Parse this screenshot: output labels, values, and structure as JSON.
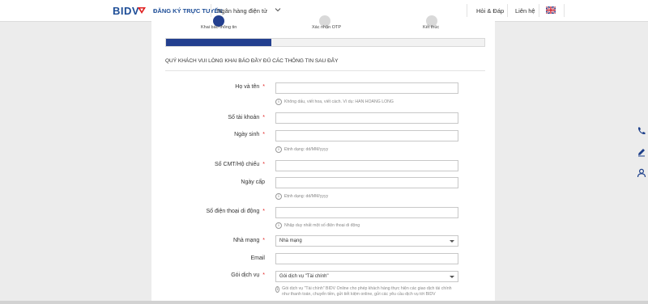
{
  "header": {
    "logo_text": "BIDV",
    "register_title": "ĐĂNG KÝ TRỰC TUYẾN",
    "dropdown_label": "Ngân hàng điện tử",
    "faq_label": "Hỏi & Đáp",
    "contact_label": "Liên hệ",
    "language_flag": "uk-flag-icon"
  },
  "steps": [
    {
      "label": "Khai báo thông tin",
      "state": "active"
    },
    {
      "label": "Xác nhận OTP",
      "state": "pending"
    },
    {
      "label": "Kết thúc",
      "state": "pending"
    }
  ],
  "progress": {
    "fraction": 0.33
  },
  "form": {
    "section_title": "QUÝ KHÁCH VUI LÒNG KHAI BÁO ĐẦY ĐỦ CÁC THÔNG TIN SAU ĐÂY",
    "required_mark": "*",
    "full_name": {
      "label": "Họ và tên",
      "value": "",
      "hint": "Không dấu, viết hoa, viết cách. Ví dụ: HAN HOANG LONG"
    },
    "account_number": {
      "label": "Số tài khoản",
      "value": ""
    },
    "birth_date": {
      "label": "Ngày sinh",
      "value": "",
      "hint": "Định dạng: dd/MM/yyyy"
    },
    "id_number": {
      "label": "Số CMT/Hộ chiếu",
      "value": ""
    },
    "issue_date": {
      "label": "Ngày cấp",
      "value": "",
      "hint": "Định dạng: dd/MM/yyyy"
    },
    "phone": {
      "label": "Số điện thoại di động",
      "value": "",
      "hint": "Nhập duy nhất một số điện thoại di động"
    },
    "carrier": {
      "label": "Nhà mạng",
      "selected": "Nhà mạng"
    },
    "email": {
      "label": "Email",
      "value": ""
    },
    "service_package": {
      "label": "Gói dịch vụ",
      "selected": "Gói dịch vụ \"Tài chính\"",
      "hint": "Gói dịch vụ \"Tài chính\" BIDV Online cho phép khách hàng thực hiện các giao dịch tài chính như thanh toán, chuyển tiền, gửi tiết kiệm online, gửi các yêu cầu dịch vụ tới BIDV"
    }
  },
  "side_icons": [
    "phone-icon",
    "edit-icon",
    "user-icon"
  ],
  "colors": {
    "brand_blue": "#1d4d97",
    "progress_blue": "#233f8f",
    "required_red": "#e02020"
  }
}
